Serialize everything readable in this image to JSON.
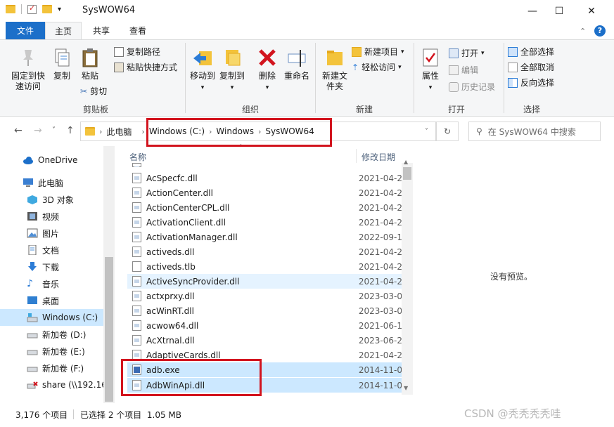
{
  "window": {
    "title": "SysWOW64"
  },
  "tabs": [
    {
      "label": "文件"
    },
    {
      "label": "主页"
    },
    {
      "label": "共享"
    },
    {
      "label": "查看"
    }
  ],
  "ribbon": {
    "clipboard": {
      "pin": "固定到快速访问",
      "copy": "复制",
      "paste": "粘贴",
      "copy_path": "复制路径",
      "paste_shortcut": "粘贴快捷方式",
      "cut": "剪切",
      "group": "剪贴板"
    },
    "organize": {
      "move_to": "移动到",
      "copy_to": "复制到",
      "delete": "删除",
      "rename": "重命名",
      "group": "组织"
    },
    "new": {
      "new_folder": "新建文件夹",
      "new_item": "新建项目",
      "easy_access": "轻松访问",
      "group": "新建"
    },
    "open": {
      "properties": "属性",
      "open": "打开",
      "edit": "编辑",
      "history": "历史记录",
      "group": "打开"
    },
    "select": {
      "select_all": "全部选择",
      "select_none": "全部取消",
      "invert": "反向选择",
      "group": "选择"
    }
  },
  "address": {
    "crumbs": [
      "此电脑",
      "Windows (C:)",
      "Windows",
      "SysWOW64"
    ],
    "search_placeholder": "在 SysWOW64 中搜索"
  },
  "nav": {
    "items": [
      {
        "label": "OneDrive"
      },
      {
        "label": "此电脑"
      },
      {
        "label": "3D 对象"
      },
      {
        "label": "视频"
      },
      {
        "label": "图片"
      },
      {
        "label": "文档"
      },
      {
        "label": "下载"
      },
      {
        "label": "音乐"
      },
      {
        "label": "桌面"
      },
      {
        "label": "Windows (C:)"
      },
      {
        "label": "新加卷 (D:)"
      },
      {
        "label": "新加卷 (E:)"
      },
      {
        "label": "新加卷 (F:)"
      },
      {
        "label": "share (\\\\192.16"
      }
    ]
  },
  "list": {
    "col_name": "名称",
    "col_date": "修改日期",
    "rows": [
      {
        "name": "AcSpecfc.dll",
        "date": "2021-04-2"
      },
      {
        "name": "ActionCenter.dll",
        "date": "2021-04-2"
      },
      {
        "name": "ActionCenterCPL.dll",
        "date": "2021-04-2"
      },
      {
        "name": "ActivationClient.dll",
        "date": "2021-04-2"
      },
      {
        "name": "ActivationManager.dll",
        "date": "2022-09-1"
      },
      {
        "name": "activeds.dll",
        "date": "2021-04-2"
      },
      {
        "name": "activeds.tlb",
        "date": "2021-04-2"
      },
      {
        "name": "ActiveSyncProvider.dll",
        "date": "2021-04-2"
      },
      {
        "name": "actxprxy.dll",
        "date": "2023-03-0"
      },
      {
        "name": "acWinRT.dll",
        "date": "2023-03-0"
      },
      {
        "name": "acwow64.dll",
        "date": "2021-06-1"
      },
      {
        "name": "AcXtrnal.dll",
        "date": "2023-06-2"
      },
      {
        "name": "AdaptiveCards.dll",
        "date": "2021-04-2"
      },
      {
        "name": "adb.exe",
        "date": "2014-11-0"
      },
      {
        "name": "AdbWinApi.dll",
        "date": "2014-11-0"
      }
    ]
  },
  "preview": {
    "text": "没有预览。"
  },
  "status": {
    "count": "3,176 个项目",
    "selection": "已选择 2 个项目  1.05 MB"
  },
  "watermark": "CSDN @秃秃秃秃哇"
}
